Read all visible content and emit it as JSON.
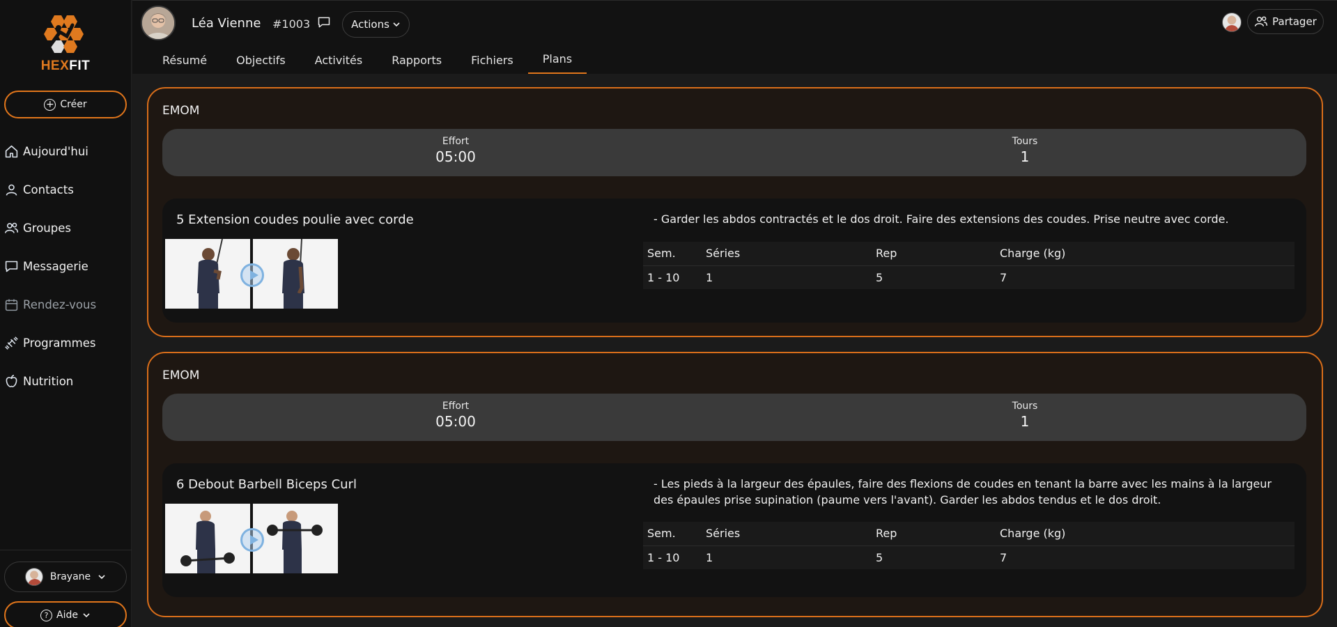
{
  "brand": {
    "name_part1": "HEX",
    "name_part2": "FIT"
  },
  "sidebar": {
    "create_label": "Créer",
    "items": [
      {
        "label": "Aujourd'hui",
        "icon": "home-icon"
      },
      {
        "label": "Contacts",
        "icon": "user-icon"
      },
      {
        "label": "Groupes",
        "icon": "users-icon"
      },
      {
        "label": "Messagerie",
        "icon": "chat-icon"
      },
      {
        "label": "Rendez-vous",
        "icon": "calendar-icon"
      },
      {
        "label": "Programmes",
        "icon": "dumbbell-icon"
      },
      {
        "label": "Nutrition",
        "icon": "apple-icon"
      }
    ],
    "user_label": "Brayane",
    "help_label": "Aide"
  },
  "header": {
    "client_name": "Léa Vienne",
    "client_id": "#1003",
    "actions_label": "Actions",
    "share_label": "Partager",
    "tabs": [
      "Résumé",
      "Objectifs",
      "Activités",
      "Rapports",
      "Fichiers",
      "Plans"
    ],
    "active_tab": "Plans"
  },
  "blocks": [
    {
      "title": "EMOM",
      "effort_label": "Effort",
      "effort_value": "05:00",
      "rounds_label": "Tours",
      "rounds_value": "1",
      "exercise": {
        "name": "5 Extension coudes poulie avec corde",
        "description": "- Garder les abdos contractés et le dos droit. Faire des extensions des coudes. Prise neutre avec corde.",
        "columns": [
          "Sem.",
          "Séries",
          "Rep",
          "Charge (kg)"
        ],
        "rows": [
          [
            "1 - 10",
            "1",
            "5",
            "7"
          ]
        ]
      }
    },
    {
      "title": "EMOM",
      "effort_label": "Effort",
      "effort_value": "05:00",
      "rounds_label": "Tours",
      "rounds_value": "1",
      "exercise": {
        "name": "6 Debout Barbell Biceps Curl",
        "description": "- Les pieds à la largeur des épaules, faire des flexions de coudes en tenant la barre avec les mains à la largeur des épaules prise supination (paume vers l'avant). Garder les abdos tendus et le dos droit.",
        "columns": [
          "Sem.",
          "Séries",
          "Rep",
          "Charge (kg)"
        ],
        "rows": [
          [
            "1 - 10",
            "1",
            "5",
            "7"
          ]
        ]
      }
    }
  ],
  "colors": {
    "accent": "#e2761b",
    "background": "#1b1b1b",
    "sidebar": "#111111"
  }
}
